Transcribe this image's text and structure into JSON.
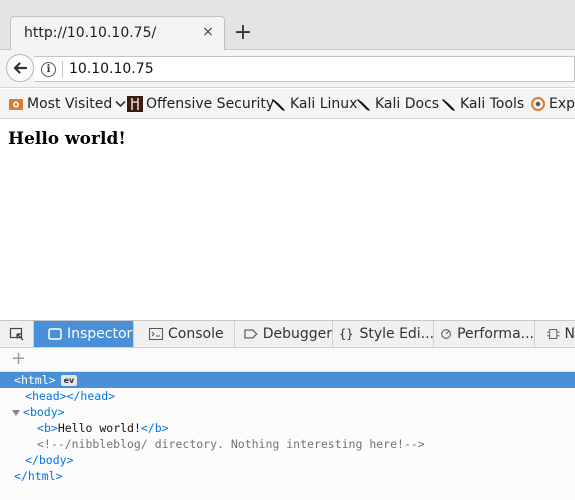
{
  "tab": {
    "title": "http://10.10.10.75/",
    "close": "×",
    "new_tab": "+"
  },
  "nav": {
    "url": "10.10.10.75",
    "info": "i"
  },
  "bookmarks": [
    {
      "label": "Most Visited",
      "icon": "gear-icon",
      "dropdown": true
    },
    {
      "label": "Offensive Security",
      "icon": "offsec-icon"
    },
    {
      "label": "Kali Linux",
      "icon": "kali-dragon-icon"
    },
    {
      "label": "Kali Docs",
      "icon": "kali-dragon-icon"
    },
    {
      "label": "Kali Tools",
      "icon": "kali-dragon-icon"
    },
    {
      "label": "Expl",
      "icon": "exploit-db-icon"
    }
  ],
  "page": {
    "heading": "Hello world!"
  },
  "devtools": {
    "tabs": [
      {
        "label": "Inspector",
        "icon": "inspector-icon",
        "active": true
      },
      {
        "label": "Console",
        "icon": "console-icon"
      },
      {
        "label": "Debugger",
        "icon": "debugger-icon"
      },
      {
        "label": "Style Edi...",
        "icon": "braces-icon"
      },
      {
        "label": "Performa...",
        "icon": "performance-icon"
      },
      {
        "label": "N",
        "icon": "network-icon"
      }
    ],
    "toolbar": {
      "add_node": "+"
    },
    "markup": {
      "html_open": "html",
      "ev_badge": "ev",
      "head_open": "head",
      "head_close": "/head",
      "body_open": "body",
      "b_open": "b",
      "b_text": "Hello world!",
      "b_close": "/b",
      "comment": "<!--/nibbleblog/ directory. Nothing interesting here!-->",
      "body_close": "/body",
      "html_close": "/html"
    }
  },
  "colors": {
    "accent": "#4a90d9",
    "tag": "#0074e8",
    "comment": "#737373"
  }
}
